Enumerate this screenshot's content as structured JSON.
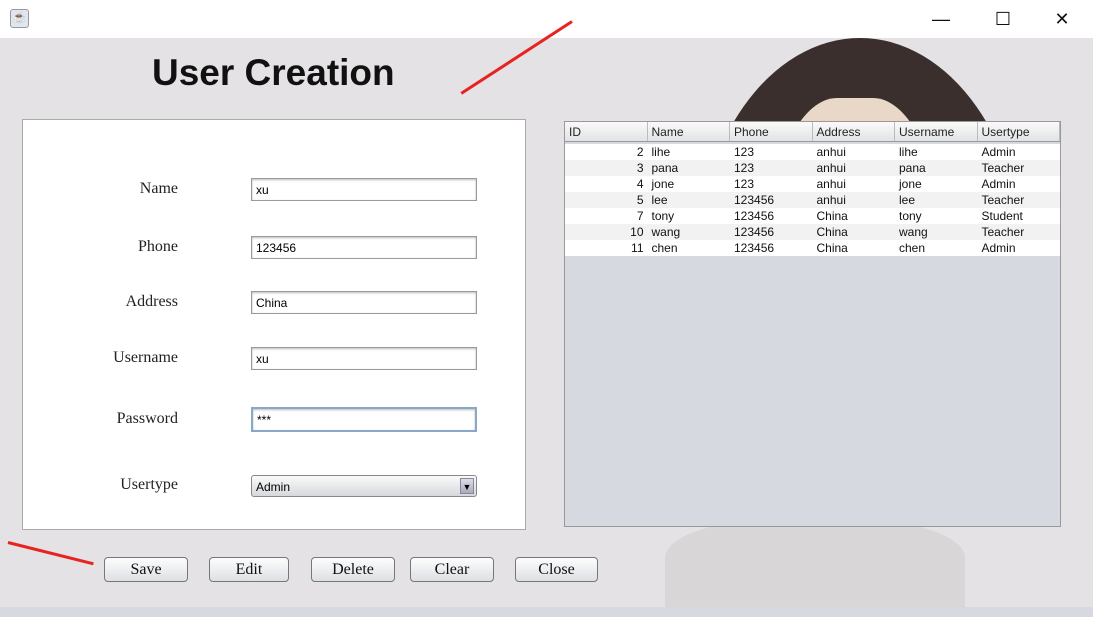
{
  "window": {
    "icon": "java-icon",
    "minimize": "minimize-icon",
    "maximize": "maximize-icon",
    "close": "close-icon"
  },
  "title": "User Creation",
  "form": {
    "fields": [
      {
        "label": "Name",
        "value": "xu"
      },
      {
        "label": "Phone",
        "value": "123456"
      },
      {
        "label": "Address",
        "value": "China"
      },
      {
        "label": "Username",
        "value": "xu"
      },
      {
        "label": "Password",
        "value": "***"
      }
    ],
    "usertype": {
      "label": "Usertype",
      "value": "Admin"
    }
  },
  "table": {
    "columns": [
      "ID",
      "Name",
      "Phone",
      "Address",
      "Username",
      "Usertype"
    ],
    "rows": [
      [
        "2",
        "lihe",
        "123",
        "anhui",
        "lihe",
        "Admin"
      ],
      [
        "3",
        "pana",
        "123",
        "anhui",
        "pana",
        "Teacher"
      ],
      [
        "4",
        "jone",
        "123",
        "anhui",
        "jone",
        "Admin"
      ],
      [
        "5",
        "lee",
        "123456",
        "anhui",
        "lee",
        "Teacher"
      ],
      [
        "7",
        "tony",
        "123456",
        "China",
        "tony",
        "Student"
      ],
      [
        "10",
        "wang",
        "123456",
        "China",
        "wang",
        "Teacher"
      ],
      [
        "11",
        "chen",
        "123456",
        "China",
        "chen",
        "Admin"
      ]
    ]
  },
  "buttons": {
    "save": "Save",
    "edit": "Edit",
    "delete": "Delete",
    "clear": "Clear",
    "close": "Close"
  },
  "colors": {
    "annotation_arrow": "#e8231f"
  }
}
